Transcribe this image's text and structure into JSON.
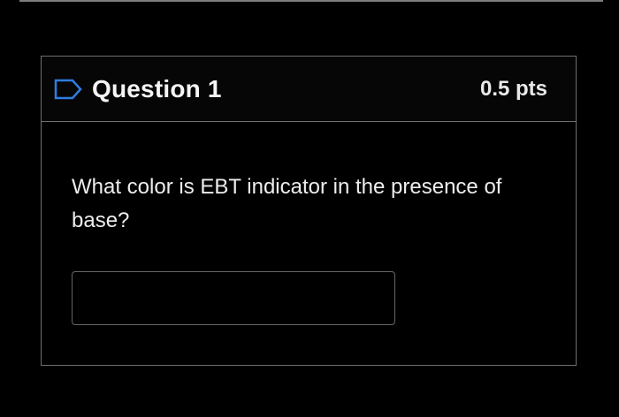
{
  "question": {
    "title": "Question 1",
    "points": "0.5 pts",
    "text": "What color is EBT indicator in the presence of base?",
    "answer_value": "",
    "flag_icon": "flag-outline-icon"
  },
  "colors": {
    "background": "#000000",
    "border": "#6f6f6f",
    "text": "#f5f5f5"
  }
}
